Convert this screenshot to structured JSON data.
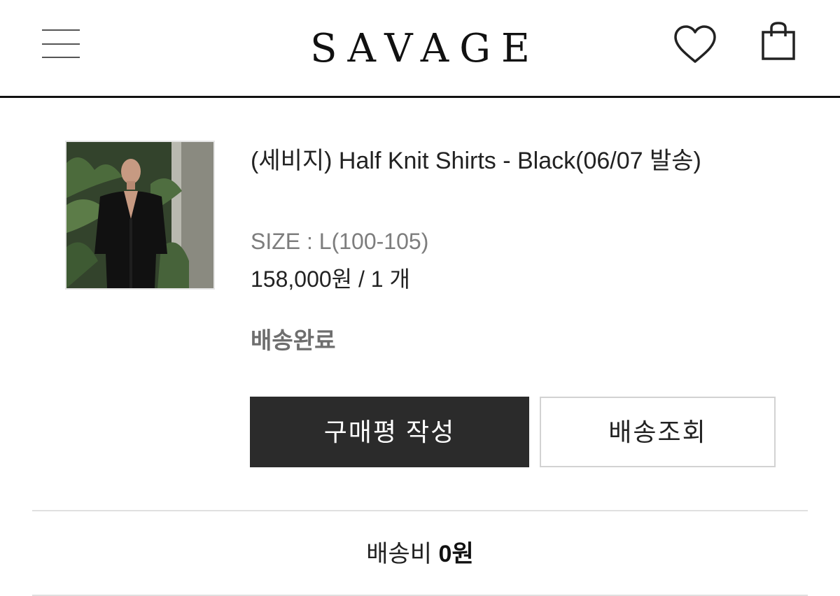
{
  "header": {
    "logo": "SAVAGE",
    "icons": [
      "menu-icon",
      "heart-icon",
      "shopping-bag-icon"
    ]
  },
  "order_item": {
    "image_alt": "model wearing black knit shirt",
    "product_name": "(세비지) Half Knit Shirts - Black(06/07 발송)",
    "option": "SIZE : L(100-105)",
    "price_quantity": "158,000원 / 1 개",
    "status": "배송완료",
    "buttons": {
      "review": "구매평 작성",
      "track": "배송조회"
    }
  },
  "summary": {
    "shipping_label": "배송비",
    "shipping_value": "0원"
  },
  "colors": {
    "primary_button": "#2b2b2b",
    "status_text": "#6e6e6e",
    "option_text": "#7d7d7d"
  }
}
